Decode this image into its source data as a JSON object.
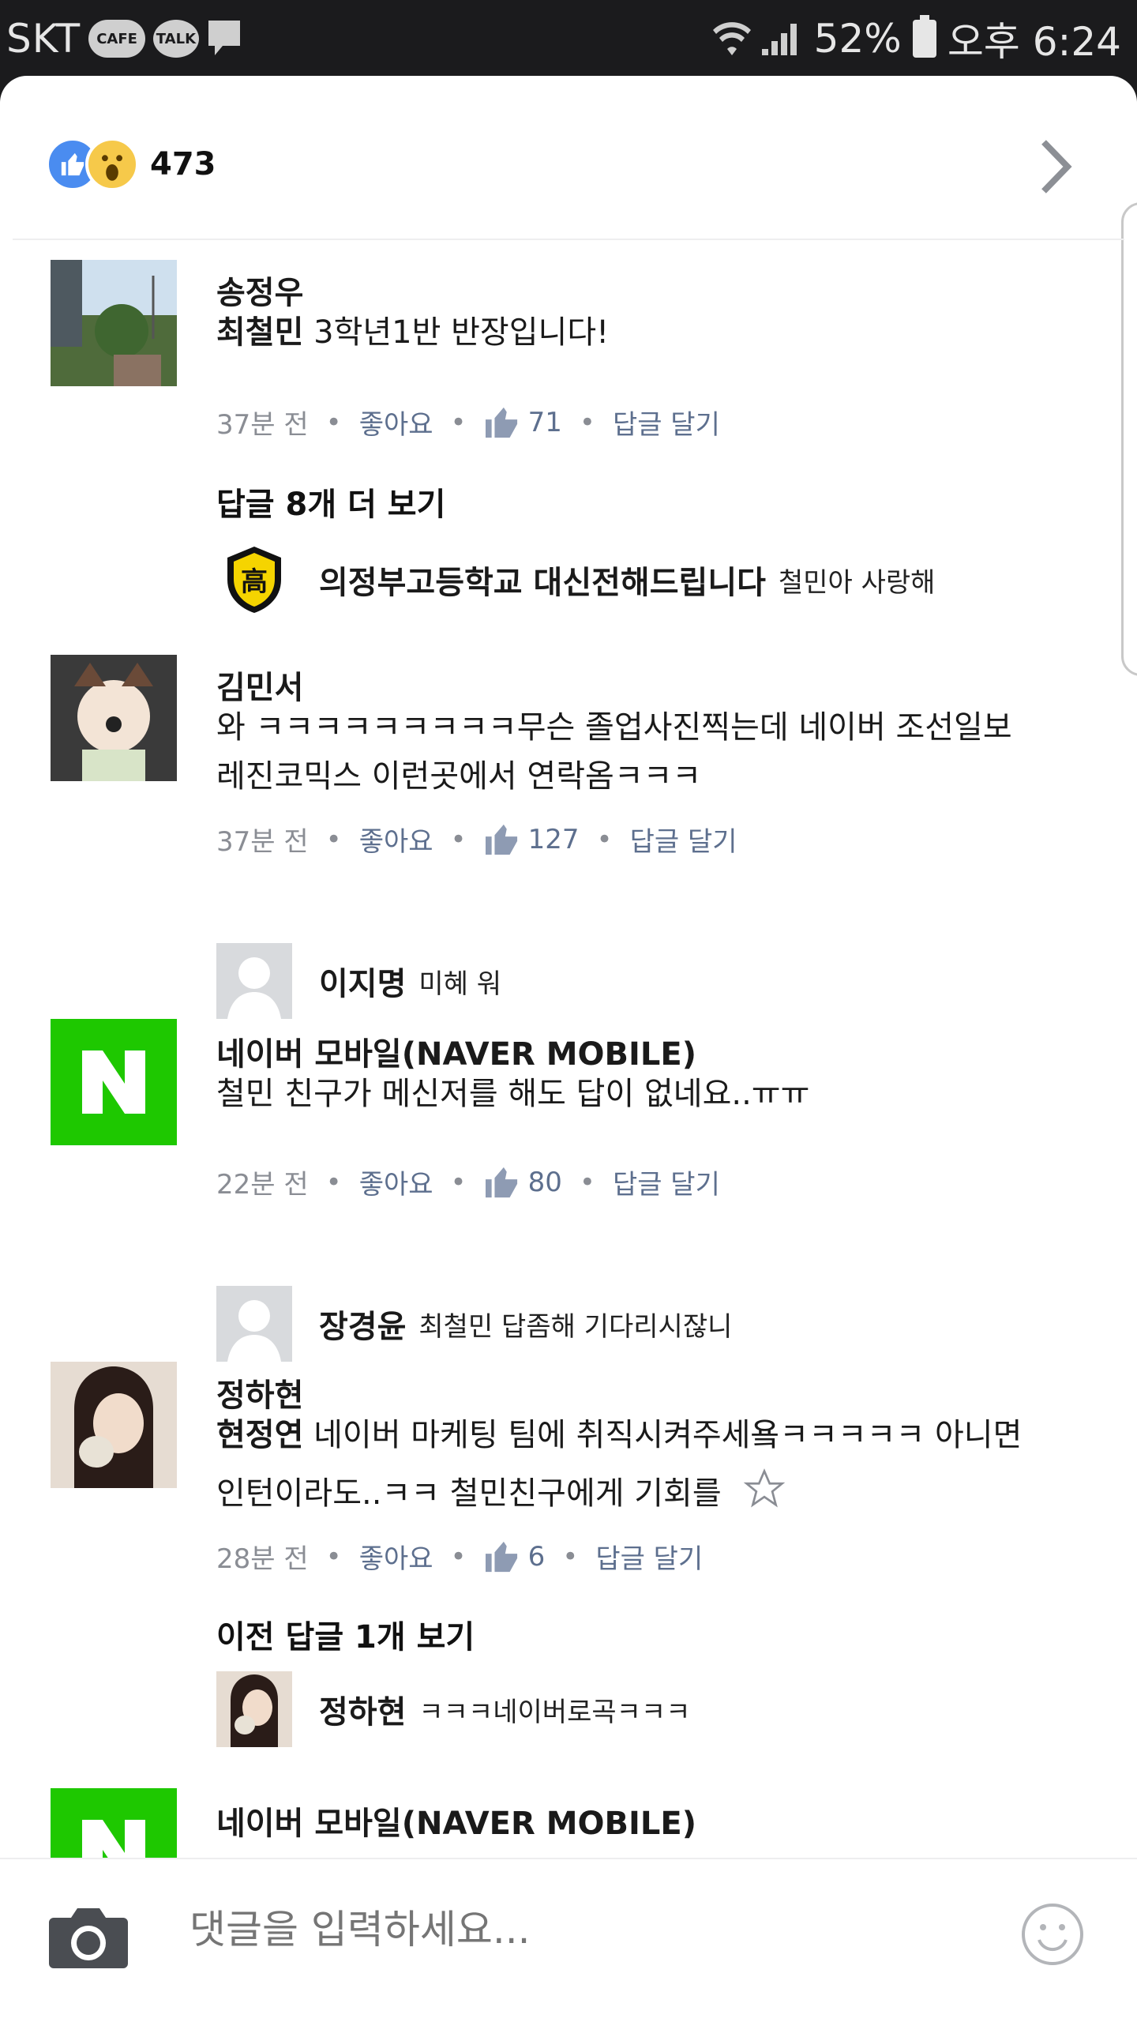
{
  "status": {
    "carrier": "SKT",
    "cafe": "CAFE",
    "talk": "TALK",
    "battery": "52%",
    "time": "오후 6:24"
  },
  "reactions": {
    "count": "473",
    "icons": [
      "like-icon",
      "wow-icon"
    ]
  },
  "comments": [
    {
      "author": "송정우",
      "mention": "최철민",
      "text": " 3학년1반 반장입니다!",
      "time": "37분 전",
      "like": "좋아요",
      "likes": "71",
      "reply": "답글 달기",
      "more": "답글 8개 더 보기",
      "reply_item": {
        "name": "의정부고등학교 대신전해드립니다",
        "text": "철민아 사랑해"
      }
    },
    {
      "author": "김민서",
      "line1": "와 ㅋㅋㅋㅋㅋㅋㅋㅋㅋ무슨 졸업사진찍는데 네이버 조선일보",
      "line2": "레진코믹스 이런곳에서 연락옴ㅋㅋㅋ",
      "time": "37분 전",
      "like": "좋아요",
      "likes": "127",
      "reply": "답글 달기",
      "reply_item": {
        "name": "이지명",
        "text": "미혜 워"
      }
    },
    {
      "author": "네이버 모바일(NAVER MOBILE)",
      "text": "철민 친구가 메신저를 해도 답이 없네요..ㅠㅠ",
      "time": "22분 전",
      "like": "좋아요",
      "likes": "80",
      "reply": "답글 달기",
      "reply_item": {
        "name": "장경윤",
        "text": "최철민 답좀해 기다리시잖니"
      }
    },
    {
      "author": "정하현",
      "mention": "현정연",
      "line1": " 네이버 마케팅 팀에 취직시켜주세욬ㅋㅋㅋㅋㅋ 아니면",
      "line2": "인턴이라도..ㅋㅋ 철민친구에게 기회를",
      "time": "28분 전",
      "like": "좋아요",
      "likes": "6",
      "reply": "답글 달기",
      "more": "이전 답글 1개 보기",
      "reply_item": {
        "name": "정하현",
        "text": "ㅋㅋㅋ네이버로곡ㅋㅋㅋ"
      }
    },
    {
      "author": "네이버 모바일(NAVER MOBILE)"
    }
  ],
  "composer": {
    "placeholder": "댓글을 입력하세요..."
  }
}
